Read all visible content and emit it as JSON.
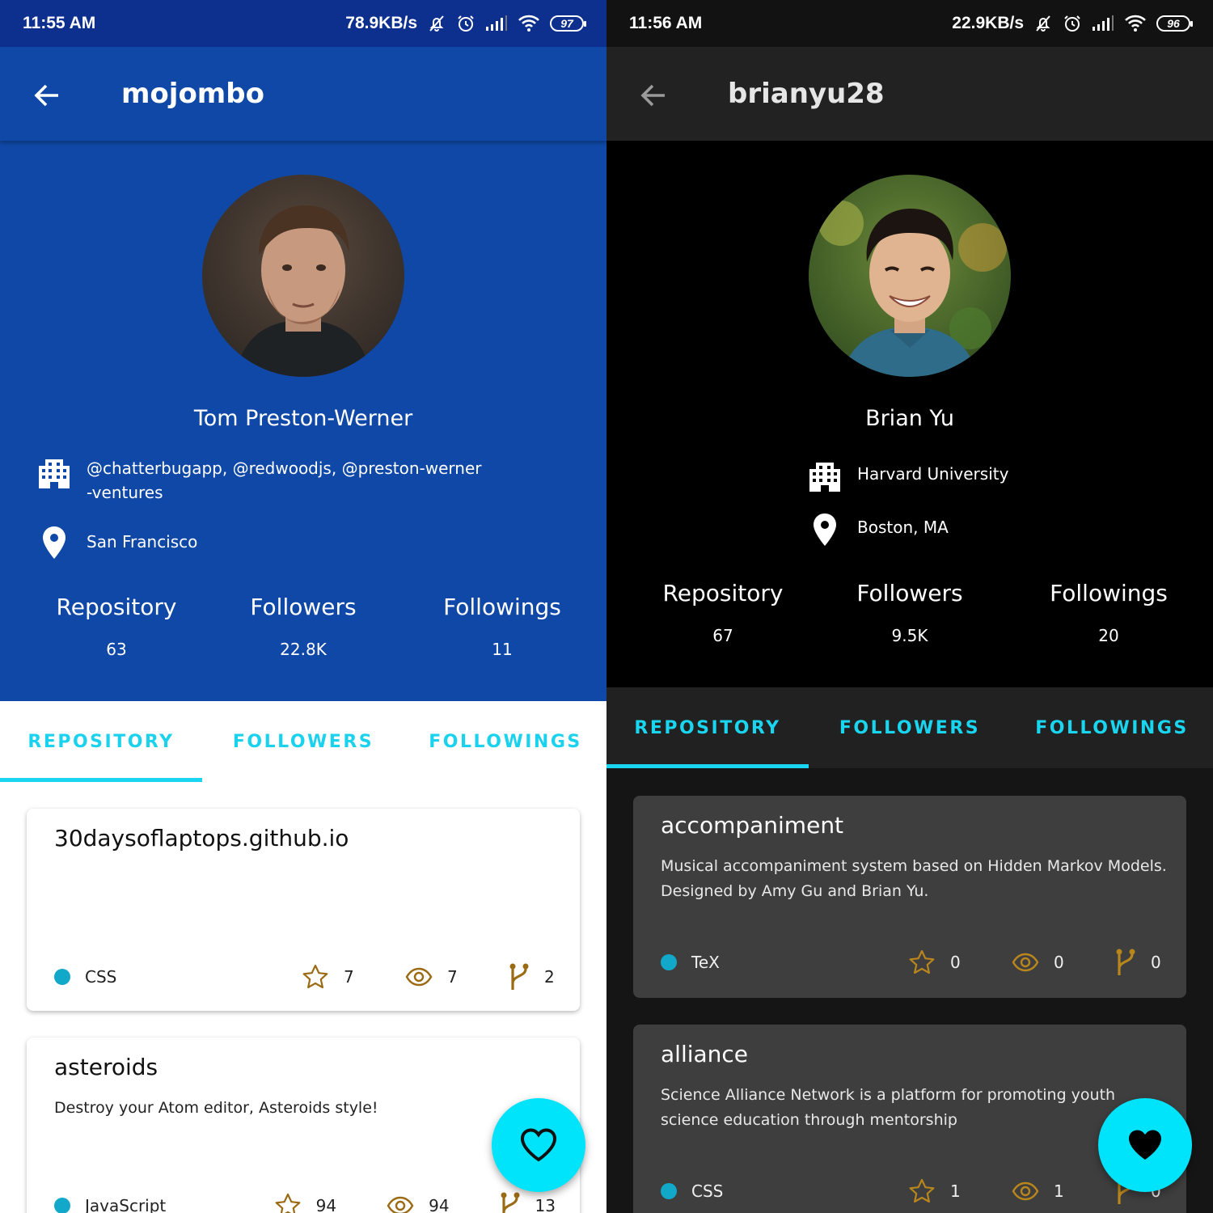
{
  "colors": {
    "light_status_bar": "#0d2f8e",
    "light_header": "#0f48a6",
    "dark_header": "#000000",
    "dark_appbar": "#222222",
    "dark_card": "#3e3e3e",
    "accent": "#19d5ef",
    "fab": "#00e4fb",
    "metric_icon": "#9b6b14",
    "language_dot": "#12a8c9"
  },
  "light": {
    "status": {
      "time": "11:55 AM",
      "speed": "78.9KB/s",
      "battery": "97"
    },
    "appbar": {
      "title": "mojombo",
      "back_icon": "arrow-left-icon"
    },
    "profile": {
      "name": "Tom Preston-Werner",
      "company_line1": "@chatterbugapp, @redwoodjs, @preston-werner",
      "company_line2": "-ventures",
      "location": "San Francisco",
      "stats": [
        {
          "label": "Repository",
          "value": "63"
        },
        {
          "label": "Followers",
          "value": "22.8K"
        },
        {
          "label": "Followings",
          "value": "11"
        }
      ]
    },
    "tabs": [
      "REPOSITORY",
      "FOLLOWERS",
      "FOLLOWINGS"
    ],
    "repos": [
      {
        "name": "30daysoflaptops.github.io",
        "description": "",
        "language": "CSS",
        "stars": "7",
        "watchers": "7",
        "forks": "2"
      },
      {
        "name": "asteroids",
        "description": "Destroy your Atom editor, Asteroids style!",
        "language": "JavaScript",
        "stars": "94",
        "watchers": "94",
        "forks": "13"
      }
    ]
  },
  "dark": {
    "status": {
      "time": "11:56 AM",
      "speed": "22.9KB/s",
      "battery": "96"
    },
    "appbar": {
      "title": "brianyu28",
      "back_icon": "arrow-left-icon"
    },
    "profile": {
      "name": "Brian Yu",
      "company": "Harvard University",
      "location": "Boston, MA",
      "stats": [
        {
          "label": "Repository",
          "value": "67"
        },
        {
          "label": "Followers",
          "value": "9.5K"
        },
        {
          "label": "Followings",
          "value": "20"
        }
      ]
    },
    "tabs": [
      "REPOSITORY",
      "FOLLOWERS",
      "FOLLOWINGS"
    ],
    "repos": [
      {
        "name": "accompaniment",
        "description": "Musical accompaniment system based on Hidden Markov Models. Designed by Amy Gu and Brian Yu.",
        "language": "TeX",
        "stars": "0",
        "watchers": "0",
        "forks": "0"
      },
      {
        "name": "alliance",
        "description": "Science Alliance Network is a platform for promoting youth science education through mentorship",
        "language": "CSS",
        "stars": "1",
        "watchers": "1",
        "forks": "0"
      }
    ]
  }
}
